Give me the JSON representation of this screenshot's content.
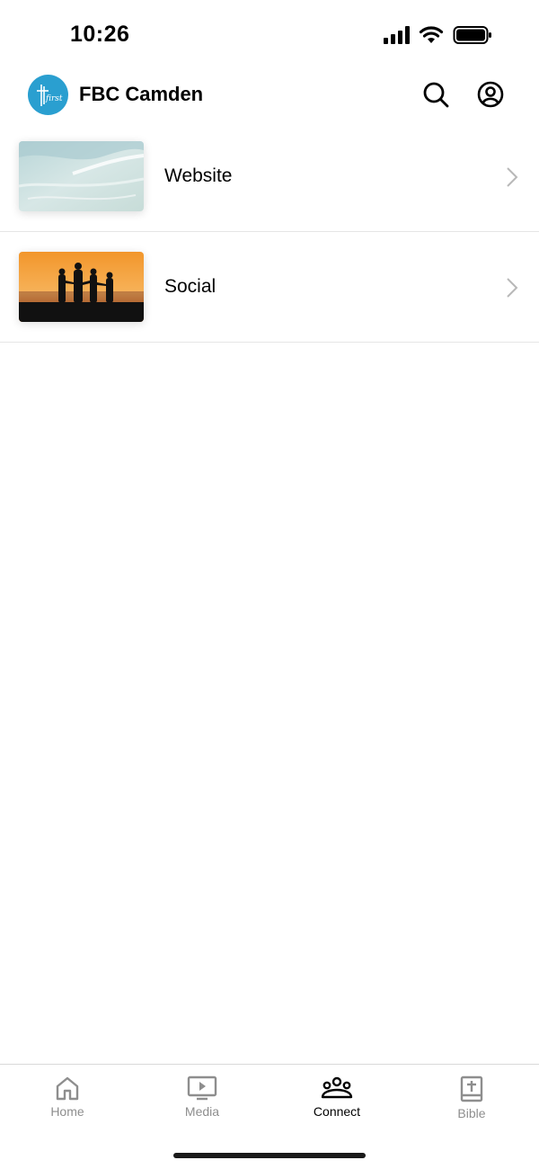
{
  "status_bar": {
    "time": "10:26"
  },
  "header": {
    "title": "FBC Camden",
    "logo_text": "first"
  },
  "list": {
    "items": [
      {
        "label": "Website",
        "thumbnail": "ocean-waves-image"
      },
      {
        "label": "Social",
        "thumbnail": "sunset-silhouette-image"
      }
    ]
  },
  "tabbar": {
    "tabs": [
      {
        "label": "Home",
        "icon": "home-icon",
        "active": false
      },
      {
        "label": "Media",
        "icon": "media-icon",
        "active": false
      },
      {
        "label": "Connect",
        "icon": "connect-icon",
        "active": true
      },
      {
        "label": "Bible",
        "icon": "bible-icon",
        "active": false
      }
    ]
  },
  "colors": {
    "brand": "#2a9fd0",
    "active_tab": "#000000",
    "inactive_tab": "#8e8e8e",
    "divider": "#e6e6e6"
  }
}
